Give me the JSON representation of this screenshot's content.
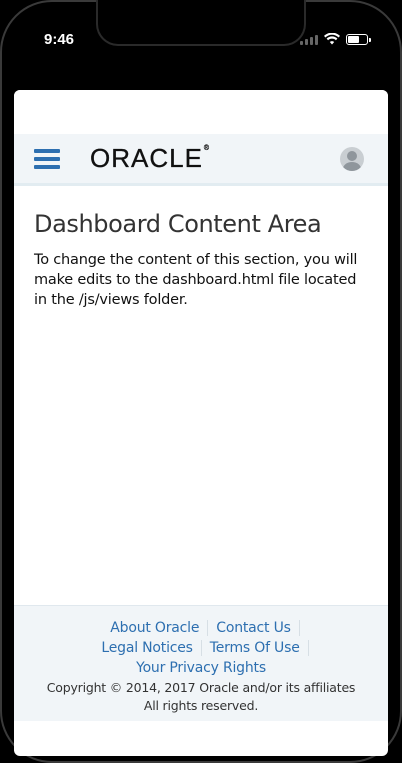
{
  "status_bar": {
    "time": "9:46"
  },
  "header": {
    "logo_text": "ORACLE",
    "logo_mark": "®",
    "menu_icon": "hamburger-menu-icon",
    "avatar_icon": "user-avatar-icon"
  },
  "main": {
    "title": "Dashboard Content Area",
    "body": "To change the content of this section, you will make edits to the dashboard.html file located in the /js/views folder."
  },
  "footer": {
    "links": [
      {
        "label": "About Oracle"
      },
      {
        "label": "Contact Us"
      },
      {
        "label": "Legal Notices"
      },
      {
        "label": "Terms Of Use"
      },
      {
        "label": "Your Privacy Rights"
      }
    ],
    "copyright": "Copyright © 2014, 2017 Oracle and/or its affiliates",
    "rights": "All rights reserved."
  },
  "colors": {
    "link": "#2d6fb0",
    "header_bg": "#f1f5f8"
  }
}
